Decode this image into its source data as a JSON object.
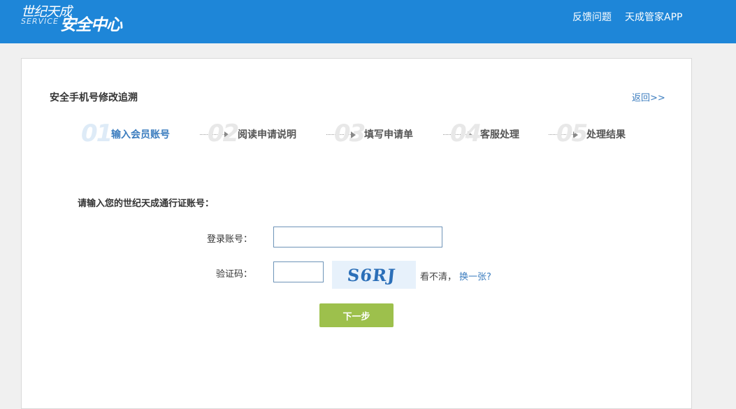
{
  "header": {
    "logo_top": "世纪天成",
    "logo_service": "SERVICE",
    "logo_main": "安全中心",
    "nav": [
      {
        "label": "反馈问题"
      },
      {
        "label": "天成管家APP"
      }
    ]
  },
  "panel": {
    "title": "安全手机号修改追溯",
    "back_label": "返回>>",
    "steps": [
      {
        "num": "01",
        "label": "输入会员账号",
        "active": true
      },
      {
        "num": "02",
        "label": "阅读申请说明",
        "active": false
      },
      {
        "num": "03",
        "label": "填写申请单",
        "active": false
      },
      {
        "num": "04",
        "label": "客服处理",
        "active": false
      },
      {
        "num": "05",
        "label": "处理结果",
        "active": false
      }
    ],
    "prompt": "请输入您的世纪天成通行证账号：",
    "form": {
      "account_label": "登录账号：",
      "account_value": "",
      "captcha_label": "验证码：",
      "captcha_value": "",
      "captcha_text": "S6RJ",
      "hint_text": "看不清，",
      "refresh_label": "换一张?",
      "next_label": "下一步"
    }
  },
  "colors": {
    "header_bg": "#1e86d8",
    "link": "#3c7dbf",
    "button_bg": "#9dc04c"
  }
}
